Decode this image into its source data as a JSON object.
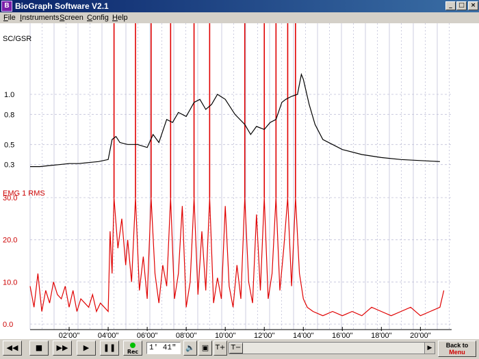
{
  "window": {
    "title": "BioGraph Software V2.1",
    "icon": "biograph-app-icon",
    "controls": {
      "minimize": "_",
      "maximize": "□",
      "close": "×"
    }
  },
  "menu": [
    "File",
    "Instruments",
    "Screen",
    "Config",
    "Help"
  ],
  "colors": {
    "sc_trace": "#000000",
    "emg_trace": "#e00000",
    "grid": "#c0c0d8",
    "emg_label": "#cc0000"
  },
  "chart_data": [
    {
      "type": "line",
      "ylabel": "SC/GSR",
      "ytick_labels": [
        "1.0",
        "0.8",
        "0.5",
        "0.3"
      ],
      "ylim": [
        0.25,
        1.3
      ],
      "xlim": [
        0,
        21.6
      ],
      "grid": true,
      "series": [
        {
          "name": "",
          "x": [
            0,
            0.5,
            1,
            1.5,
            2,
            2.5,
            3,
            3.5,
            4,
            4.2,
            4.4,
            4.6,
            5,
            5.5,
            6,
            6.3,
            6.6,
            7,
            7.3,
            7.6,
            8,
            8.2,
            8.4,
            8.7,
            9,
            9.3,
            9.6,
            10,
            10.5,
            11,
            11.3,
            11.6,
            12,
            12.3,
            12.6,
            12.9,
            13.1,
            13.4,
            13.7,
            13.9,
            14,
            14.3,
            14.6,
            15,
            15.5,
            16,
            17,
            18,
            19,
            20,
            21
          ],
          "y": [
            0.28,
            0.28,
            0.29,
            0.3,
            0.31,
            0.31,
            0.32,
            0.33,
            0.35,
            0.55,
            0.58,
            0.52,
            0.5,
            0.5,
            0.47,
            0.6,
            0.52,
            0.75,
            0.72,
            0.82,
            0.78,
            0.85,
            0.92,
            0.95,
            0.85,
            0.9,
            1.0,
            0.95,
            0.8,
            0.7,
            0.6,
            0.68,
            0.65,
            0.72,
            0.75,
            0.92,
            0.95,
            0.98,
            1.0,
            1.2,
            1.15,
            0.9,
            0.7,
            0.55,
            0.5,
            0.45,
            0.4,
            0.37,
            0.35,
            0.34,
            0.33
          ]
        }
      ]
    },
    {
      "type": "line",
      "ylabel": "EMG 1 RMS",
      "ytick_labels": [
        "30.0",
        "20.0",
        "10.0",
        "0.0"
      ],
      "ylim": [
        0,
        30
      ],
      "xlim": [
        0,
        21.6
      ],
      "x_tick_labels": [
        "02'00\"",
        "04'00\"",
        "06'00\"",
        "08'00\"",
        "10'00\"",
        "12'00\"",
        "14'00\"",
        "16'00\"",
        "18'00\"",
        "20'00\""
      ],
      "grid": true,
      "series": [
        {
          "name": "",
          "x": [
            0,
            0.2,
            0.4,
            0.6,
            0.8,
            1,
            1.2,
            1.4,
            1.6,
            1.8,
            2,
            2.2,
            2.4,
            2.6,
            2.8,
            3,
            3.2,
            3.4,
            3.6,
            3.8,
            4,
            4.1,
            4.2,
            4.3,
            4.5,
            4.7,
            4.9,
            5,
            5.2,
            5.4,
            5.6,
            5.8,
            6,
            6.2,
            6.4,
            6.6,
            6.8,
            7,
            7.2,
            7.4,
            7.6,
            7.8,
            8,
            8.2,
            8.4,
            8.6,
            8.8,
            9,
            9.2,
            9.4,
            9.6,
            9.8,
            10,
            10.2,
            10.4,
            10.6,
            10.8,
            11,
            11.2,
            11.4,
            11.6,
            11.8,
            12,
            12.2,
            12.4,
            12.6,
            12.8,
            13,
            13.2,
            13.4,
            13.6,
            13.8,
            14,
            14.2,
            14.5,
            15,
            15.5,
            16,
            16.5,
            17,
            17.5,
            18,
            18.5,
            19,
            19.5,
            20,
            20.5,
            21,
            21.2
          ],
          "y": [
            9,
            4,
            12,
            3,
            8,
            5,
            10,
            7,
            6,
            9,
            4,
            8,
            3,
            6,
            5,
            4,
            7,
            3,
            5,
            4,
            3,
            22,
            12,
            30,
            18,
            25,
            14,
            20,
            10,
            30,
            8,
            16,
            6,
            30,
            12,
            5,
            14,
            9,
            30,
            6,
            12,
            28,
            4,
            10,
            30,
            7,
            22,
            8,
            30,
            5,
            11,
            6,
            28,
            9,
            4,
            14,
            6,
            30,
            10,
            5,
            26,
            8,
            30,
            6,
            12,
            30,
            8,
            18,
            30,
            9,
            30,
            12,
            6,
            4,
            3,
            2,
            3,
            2,
            3,
            2,
            4,
            3,
            2,
            3,
            4,
            2,
            3,
            4,
            8
          ]
        }
      ]
    }
  ],
  "toolbar": {
    "rewind_icon": "fast-rewind-icon",
    "stop_icon": "stop-icon",
    "fast_forward_icon": "fast-forward-icon",
    "play_icon": "play-icon",
    "pause_icon": "pause-icon",
    "rec_label": "Rec",
    "time_value": "1' 41\"",
    "back_label_1": "Back to",
    "back_label_2": "Menu"
  }
}
